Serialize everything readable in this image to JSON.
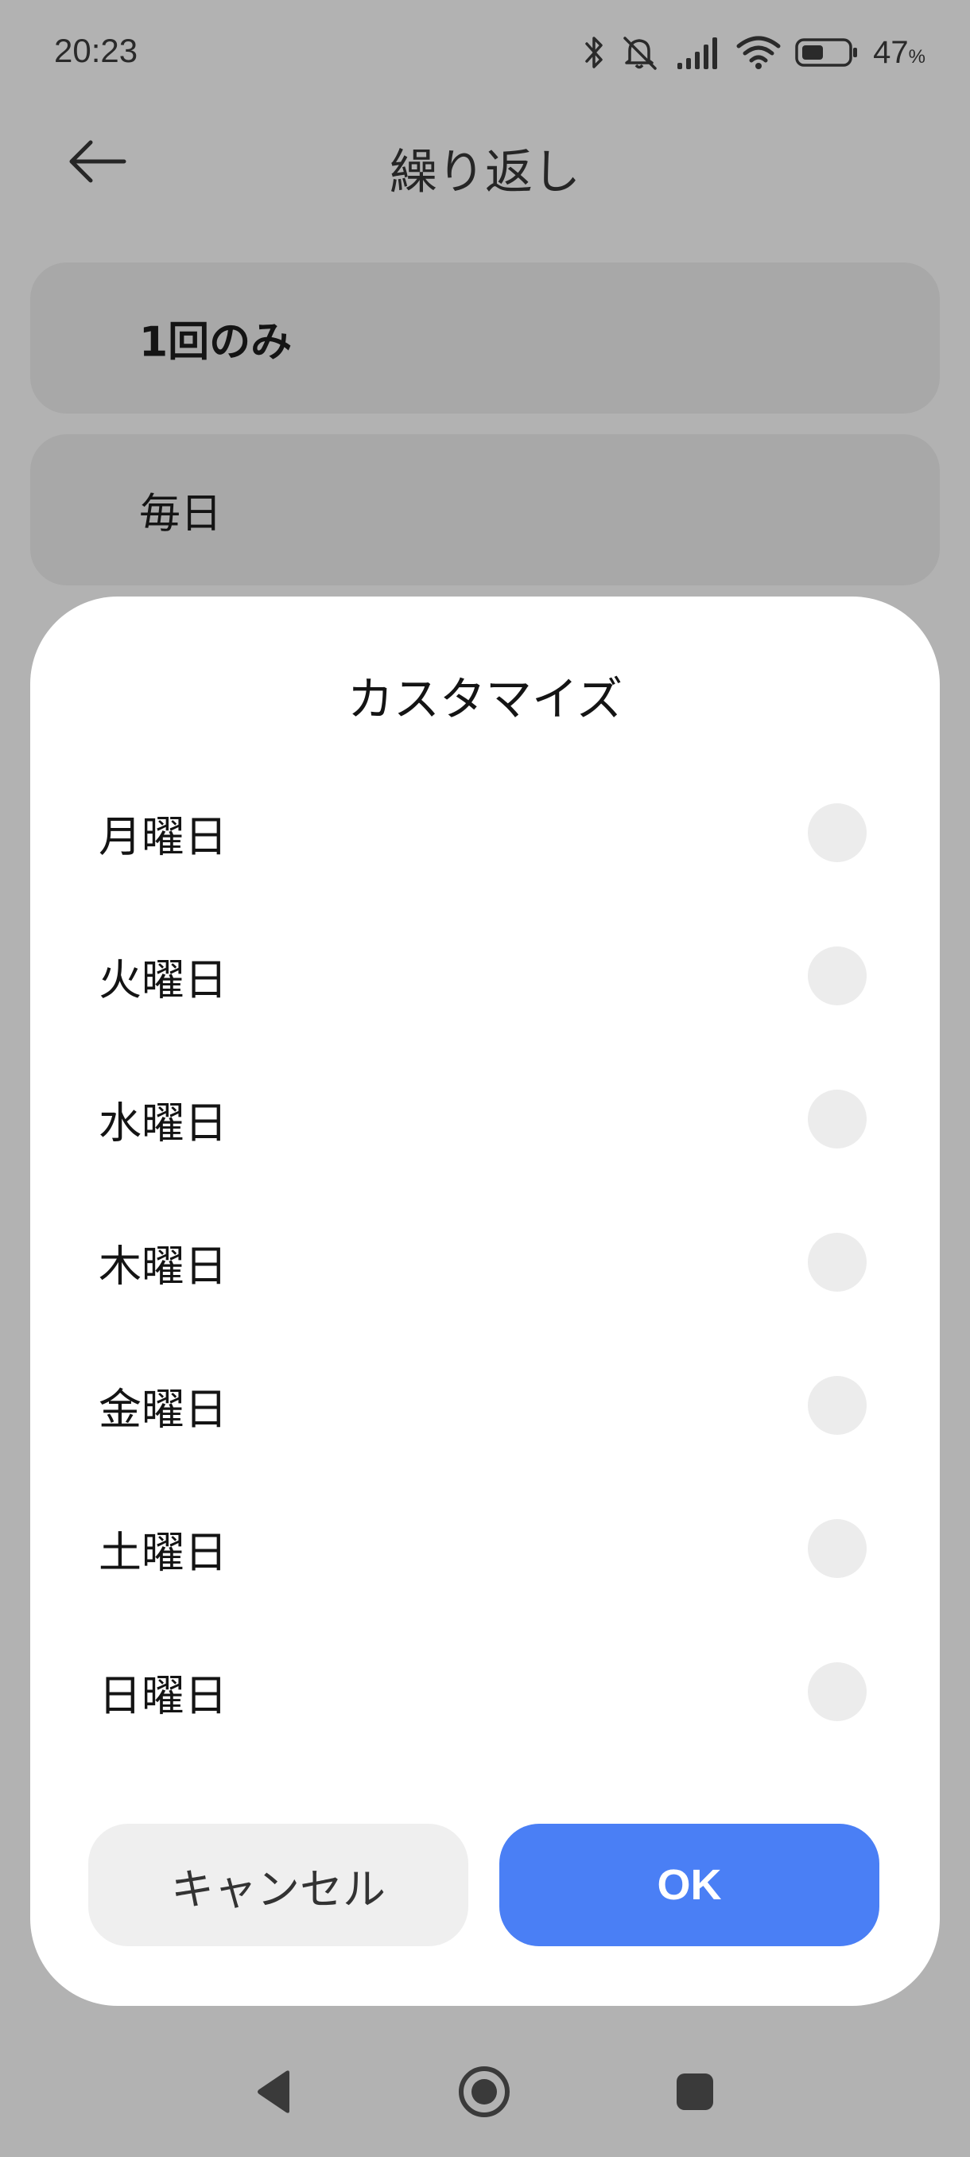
{
  "status_bar": {
    "time": "20:23",
    "battery_percent": "47",
    "battery_unit": "%",
    "icons": [
      "bluetooth-icon",
      "mute-icon",
      "signal-icon",
      "wifi-icon",
      "battery-icon"
    ]
  },
  "header": {
    "title": "繰り返し",
    "back_icon": "back-arrow-icon"
  },
  "options": [
    {
      "label": "1回のみ"
    },
    {
      "label": "毎日"
    }
  ],
  "dialog": {
    "title": "カスタマイズ",
    "days": [
      {
        "label": "月曜日",
        "checked": false
      },
      {
        "label": "火曜日",
        "checked": false
      },
      {
        "label": "水曜日",
        "checked": false
      },
      {
        "label": "木曜日",
        "checked": false
      },
      {
        "label": "金曜日",
        "checked": false
      },
      {
        "label": "土曜日",
        "checked": false
      },
      {
        "label": "日曜日",
        "checked": false
      }
    ],
    "cancel_label": "キャンセル",
    "ok_label": "OK"
  },
  "colors": {
    "accent": "#4a7ff5",
    "scrim_background": "#b2b2b2",
    "dialog_background": "#ffffff"
  },
  "nav_bar": {
    "icons": [
      "nav-back-icon",
      "nav-home-icon",
      "nav-recents-icon"
    ]
  }
}
